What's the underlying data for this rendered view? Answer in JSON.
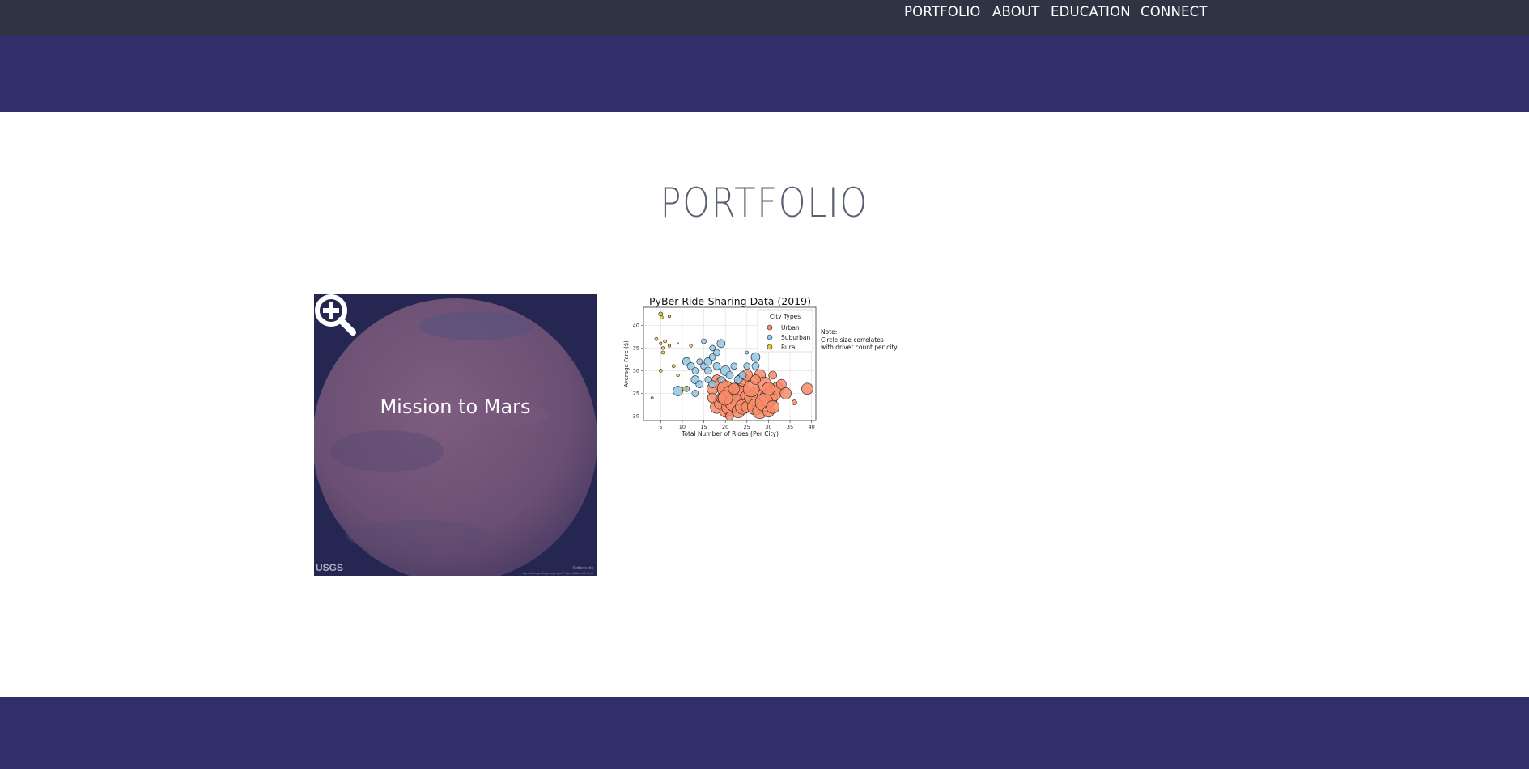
{
  "nav": {
    "items": [
      "PORTFOLIO",
      "ABOUT",
      "EDUCATION",
      "CONNECT"
    ]
  },
  "portfolio": {
    "title": "PORTFOLIO",
    "tiles": [
      {
        "caption": "Mission to Mars",
        "icon": "zoom-in-icon",
        "logo_text": "USGS",
        "credit_text": "©others etc",
        "url_text": "http://astrogeology.usgs.gov/Projects/MarsViewer/"
      }
    ]
  },
  "colors": {
    "nav_bg": "#2f3444",
    "band": "#31306a",
    "title": "#5b6170",
    "urban": "#f88a67",
    "suburban": "#8ec8e8",
    "rural": "#f2c230"
  },
  "chart_data": {
    "type": "scatter",
    "title": "PyBer Ride-Sharing Data (2019)",
    "xlabel": "Total Number of Rides (Per City)",
    "ylabel": "Average Fare ($)",
    "xlim": [
      1,
      41
    ],
    "ylim": [
      19,
      44
    ],
    "xticks": [
      5,
      10,
      15,
      20,
      25,
      30,
      35,
      40
    ],
    "yticks": [
      20,
      25,
      30,
      35,
      40
    ],
    "grid": true,
    "legend": {
      "title": "City Types",
      "placement": "top-right",
      "entries": [
        "Urban",
        "Suburban",
        "Rural"
      ]
    },
    "note": [
      "Note:",
      "Circle size correlates",
      "with driver count per city."
    ],
    "series": [
      {
        "name": "Urban",
        "color": "#f88a67",
        "points": [
          [
            17,
            26
          ],
          [
            18,
            28
          ],
          [
            19,
            27
          ],
          [
            20,
            26
          ],
          [
            21,
            25
          ],
          [
            22,
            24
          ],
          [
            23,
            26
          ],
          [
            24,
            25
          ],
          [
            25,
            24
          ],
          [
            26,
            23
          ],
          [
            27,
            25
          ],
          [
            28,
            29
          ],
          [
            29,
            27
          ],
          [
            30,
            24
          ],
          [
            31,
            25
          ],
          [
            32,
            26
          ],
          [
            33,
            27
          ],
          [
            34,
            25
          ],
          [
            18,
            22
          ],
          [
            19,
            23
          ],
          [
            20,
            21
          ],
          [
            21,
            22
          ],
          [
            22,
            23
          ],
          [
            23,
            21
          ],
          [
            24,
            22
          ],
          [
            25,
            22
          ],
          [
            26,
            24
          ],
          [
            27,
            22
          ],
          [
            28,
            21
          ],
          [
            29,
            23
          ],
          [
            30,
            21
          ],
          [
            31,
            22
          ],
          [
            19,
            24
          ],
          [
            20,
            24
          ],
          [
            22,
            26
          ],
          [
            24,
            28
          ],
          [
            26,
            26
          ],
          [
            25,
            29
          ],
          [
            27,
            28
          ],
          [
            30,
            26
          ],
          [
            39,
            26
          ],
          [
            36,
            23
          ],
          [
            31,
            29
          ],
          [
            17,
            24
          ],
          [
            21,
            20
          ]
        ],
        "sizes": [
          14,
          12,
          16,
          20,
          18,
          14,
          16,
          22,
          18,
          20,
          16,
          14,
          18,
          22,
          20,
          16,
          12,
          14,
          16,
          18,
          14,
          20,
          22,
          16,
          18,
          14,
          16,
          20,
          18,
          22,
          14,
          16,
          12,
          18,
          14,
          16,
          20,
          14,
          12,
          16,
          14,
          6,
          10,
          12,
          10
        ]
      },
      {
        "name": "Suburban",
        "color": "#8ec8e8",
        "points": [
          [
            9,
            25.5
          ],
          [
            11,
            32
          ],
          [
            12,
            31
          ],
          [
            13,
            30
          ],
          [
            13,
            28
          ],
          [
            14,
            27
          ],
          [
            14,
            32
          ],
          [
            15,
            31
          ],
          [
            16,
            30
          ],
          [
            16,
            32
          ],
          [
            17,
            33
          ],
          [
            17,
            35
          ],
          [
            18,
            31
          ],
          [
            18,
            34
          ],
          [
            19,
            36
          ],
          [
            20,
            30
          ],
          [
            21,
            29
          ],
          [
            22,
            31
          ],
          [
            23,
            28
          ],
          [
            24,
            29
          ],
          [
            25,
            31
          ],
          [
            27,
            33
          ],
          [
            27,
            31
          ],
          [
            13,
            25
          ],
          [
            11,
            26
          ],
          [
            16,
            28
          ],
          [
            17,
            27
          ],
          [
            15,
            36.5
          ],
          [
            19,
            28
          ],
          [
            25,
            34
          ]
        ],
        "sizes": [
          12,
          10,
          9,
          8,
          10,
          9,
          7,
          8,
          9,
          10,
          8,
          7,
          9,
          8,
          10,
          12,
          9,
          8,
          10,
          9,
          8,
          11,
          9,
          8,
          7,
          8,
          9,
          6,
          8,
          4
        ]
      },
      {
        "name": "Rural",
        "color": "#f2c230",
        "points": [
          [
            5,
            42.5
          ],
          [
            5.2,
            41.8
          ],
          [
            7,
            42
          ],
          [
            4,
            37
          ],
          [
            5,
            36
          ],
          [
            6,
            36.5
          ],
          [
            5.5,
            35
          ],
          [
            7,
            35.5
          ],
          [
            5.5,
            34
          ],
          [
            12,
            35.5
          ],
          [
            8,
            31
          ],
          [
            5,
            30
          ],
          [
            9,
            29
          ],
          [
            10.5,
            26
          ],
          [
            3,
            24
          ],
          [
            9,
            36
          ]
        ],
        "sizes": [
          5,
          4,
          3.5,
          4,
          3.5,
          4,
          3.5,
          3.5,
          4,
          3.5,
          4,
          4,
          3.5,
          5,
          3,
          2
        ]
      }
    ]
  }
}
